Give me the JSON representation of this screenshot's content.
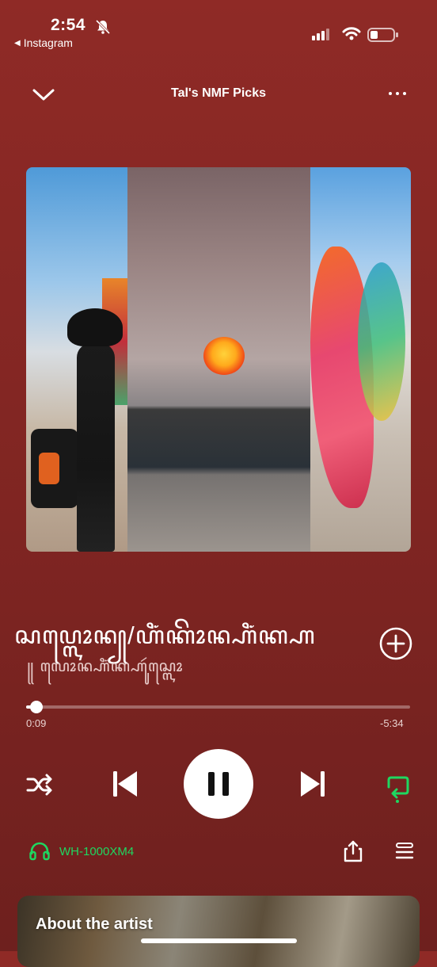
{
  "status_bar": {
    "time": "2:54",
    "back_app": "Instagram"
  },
  "header": {
    "title": "Tal's NMF Picks"
  },
  "track": {
    "title": "ꦱꦥ꧀ꦭꦺꦴꦤ꧀/ꦲꦶꦁꦏꦼꦴꦤ꧀ꦲꦶꦁꦏ꧀ꦲ",
    "artist": "꧋ ꦭꦺꦴꦤ꧀ꦲꦶꦁꦏ꧀ꦲꦸꦂꦱ꧀ꦭꦺꦴ"
  },
  "progress": {
    "elapsed": "0:09",
    "remaining": "-5:34",
    "fraction": 0.027
  },
  "device": {
    "name": "WH-1000XM4"
  },
  "about": {
    "title": "About the artist"
  },
  "colors": {
    "background": "#8f2a26",
    "accent_green": "#1ed760"
  }
}
